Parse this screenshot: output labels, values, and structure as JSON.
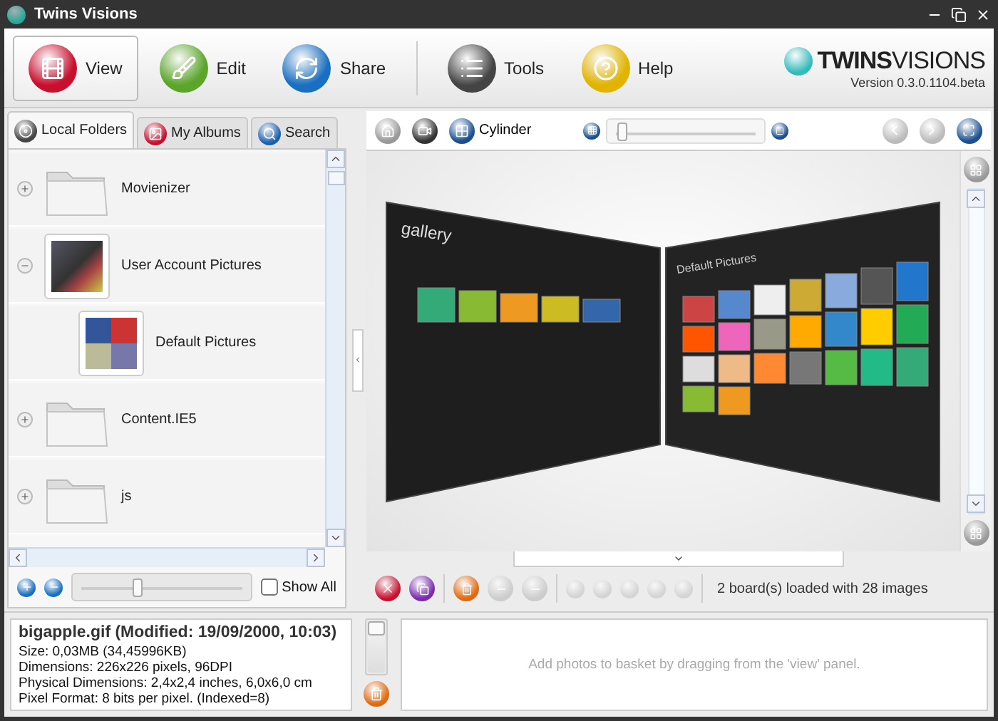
{
  "window": {
    "title": "Twins Visions"
  },
  "toolbar": [
    {
      "label": "View",
      "selected": true
    },
    {
      "label": "Edit",
      "selected": false
    },
    {
      "label": "Share",
      "selected": false
    },
    {
      "label": "Tools",
      "selected": false
    },
    {
      "label": "Help",
      "selected": false
    }
  ],
  "logo": {
    "brand_a": "TWINS",
    "brand_b": "VISIONS",
    "version": "Version 0.3.0.1104.beta"
  },
  "left_tabs": [
    {
      "label": "Local Folders",
      "selected": true
    },
    {
      "label": "My Albums",
      "selected": false
    },
    {
      "label": "Search",
      "selected": false
    }
  ],
  "tree": [
    {
      "label": "Movienizer",
      "kind": "folder",
      "expanded": false
    },
    {
      "label": "User Account Pictures",
      "kind": "thumb",
      "expanded": true,
      "children": [
        {
          "label": "Default Pictures",
          "kind": "photos"
        }
      ]
    },
    {
      "label": "Content.IE5",
      "kind": "folder",
      "expanded": false
    },
    {
      "label": "js",
      "kind": "folder",
      "expanded": false
    }
  ],
  "zoom_slider": {
    "level": 0.37
  },
  "show_all": {
    "label": "Show All",
    "checked": false
  },
  "view_toolbar": {
    "mode": "Cylinder",
    "size_slider": {
      "level": 0.04
    }
  },
  "boards": [
    {
      "title": "gallery"
    },
    {
      "title": "Default Pictures"
    }
  ],
  "status": "2 board(s) loaded with 28 images",
  "file_info": {
    "title": "bigapple.gif (Modified: 19/09/2000, 10:03)",
    "lines": [
      "Size: 0,03MB (34,45996KB)",
      "Dimensions: 226x226 pixels, 96DPI",
      "Physical Dimensions: 2,4x2,4 inches, 6,0x6,0 cm",
      "Pixel Format: 8 bits per pixel. (Indexed=8)"
    ]
  },
  "basket": {
    "slider": {
      "level": 1
    },
    "hint": "Add photos to basket by dragging from the 'view' panel."
  }
}
